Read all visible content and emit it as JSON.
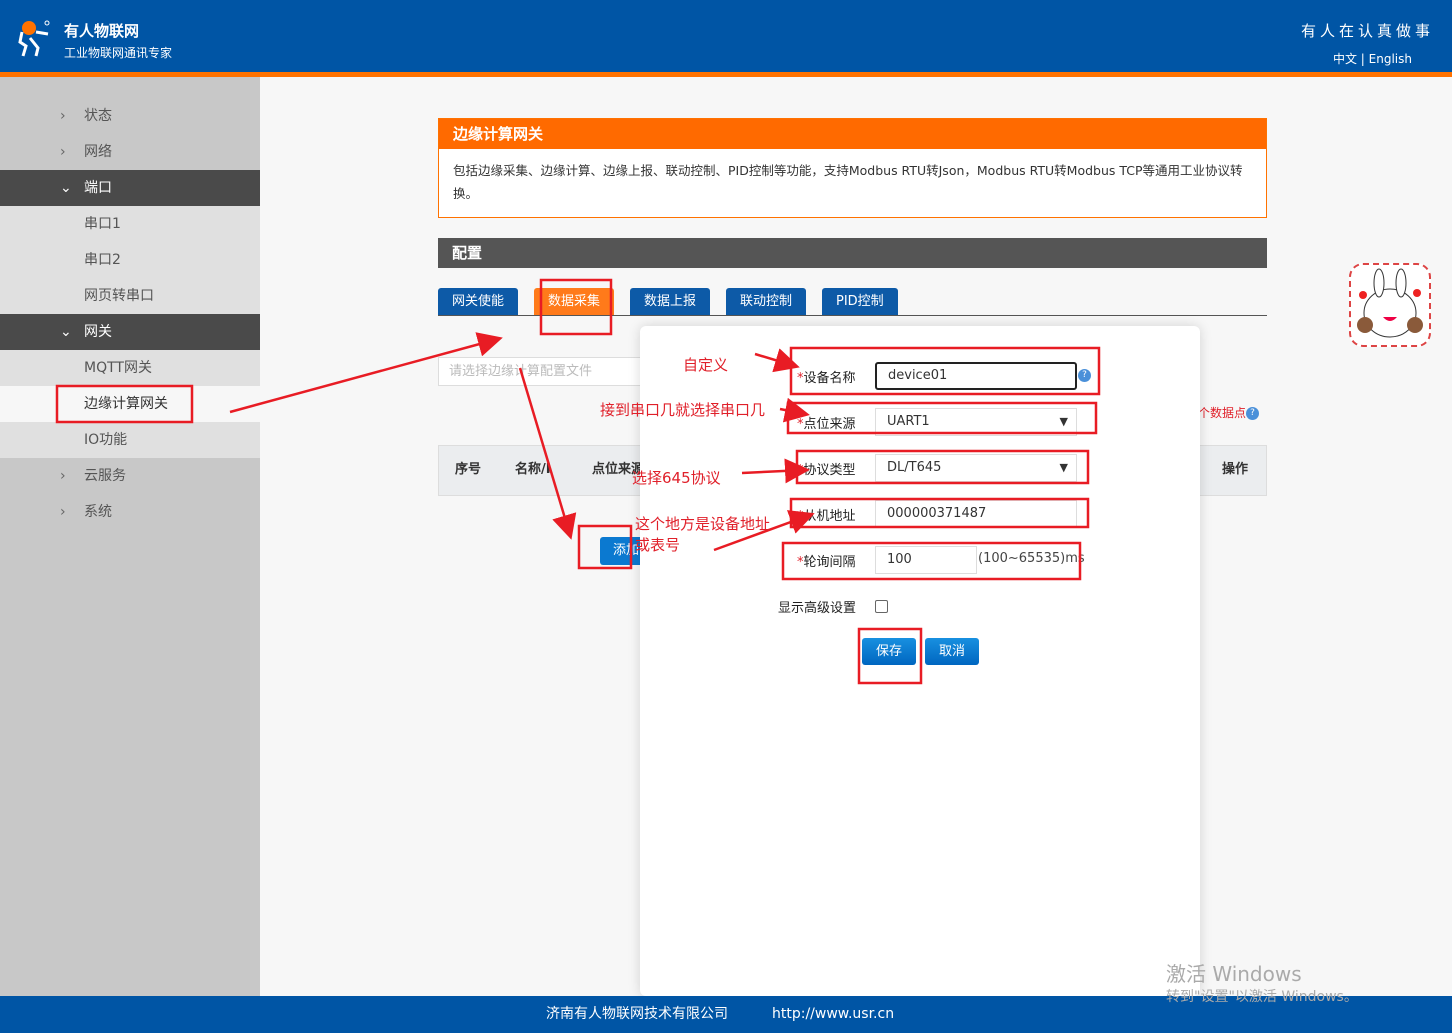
{
  "header": {
    "brand": "有人物联网",
    "slogan": "工业物联网通讯专家",
    "motto": "有人在认真做事",
    "lang": "中文 | English"
  },
  "sidebar": {
    "items": [
      {
        "label": "状态"
      },
      {
        "label": "网络"
      },
      {
        "label": "端口"
      },
      {
        "label": "串口1"
      },
      {
        "label": "串口2"
      },
      {
        "label": "网页转串口"
      },
      {
        "label": "网关"
      },
      {
        "label": "MQTT网关"
      },
      {
        "label": "边缘计算网关"
      },
      {
        "label": "IO功能"
      },
      {
        "label": "云服务"
      },
      {
        "label": "系统"
      }
    ]
  },
  "panel": {
    "title": "边缘计算网关",
    "desc": "包括边缘采集、边缘计算、边缘上报、联动控制、PID控制等功能，支持Modbus RTU转Json，Modbus RTU转Modbus TCP等通用工业协议转换。"
  },
  "config": {
    "title": "配置",
    "tabs": [
      "网关使能",
      "数据采集",
      "数据上报",
      "联动控制",
      "PID控制"
    ],
    "file_placeholder": "请选择边缘计算配置文件",
    "points_text": "个数据点",
    "table_headers": [
      "序号",
      "名称/I",
      "点位来源",
      "操作"
    ],
    "add_label": "添加"
  },
  "modal": {
    "device_name_label": "设备名称",
    "device_name": "device01",
    "source_label": "点位来源",
    "source": "UART1",
    "protocol_label": "协议类型",
    "protocol": "DL/T645",
    "slave_label": "从机地址",
    "slave": "000000371487",
    "interval_label": "轮询间隔",
    "interval": "100",
    "interval_range": "(100~65535)ms",
    "advanced_label": "显示高级设置",
    "advanced_checked": false,
    "save": "保存",
    "cancel": "取消",
    "star": "*"
  },
  "annotations": {
    "a1": "自定义",
    "a2": "接到串口几就选择串口几",
    "a3": "选择645协议",
    "a4": "这个地方是设备地址",
    "a5": "或表号"
  },
  "footer": {
    "company": "济南有人物联网技术有限公司",
    "url": "http://www.usr.cn"
  },
  "watermark": {
    "line1": "激活 Windows",
    "line2": "转到\"设置\"以激活 Windows。"
  },
  "colors": {
    "header": "#0055a5",
    "accent": "#ff7200",
    "annotation": "#e0202a"
  }
}
